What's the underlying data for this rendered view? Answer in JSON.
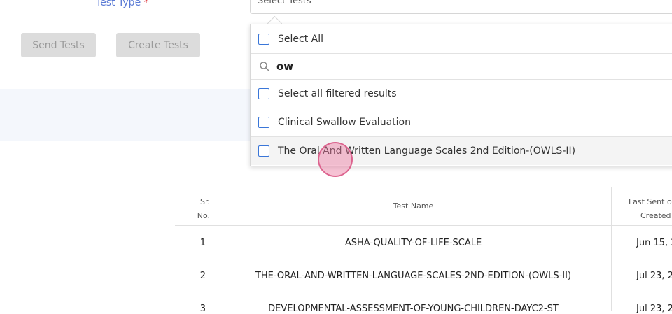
{
  "form": {
    "test_type_label": "Test Type",
    "required_mark": "*",
    "select_placeholder": "Select Tests",
    "send_tests_button": "Send Tests",
    "create_tests_button": "Create Tests"
  },
  "dropdown": {
    "select_all": "Select All",
    "search_value": "ow",
    "select_all_filtered": "Select all filtered results",
    "options": [
      {
        "label": "Clinical Swallow Evaluation",
        "checked": false
      },
      {
        "label": "The Oral And Written Language Scales 2nd Edition-(OWLS-II)",
        "checked": false
      }
    ]
  },
  "table": {
    "headers": {
      "sr_line1": "Sr.",
      "sr_line2": "No.",
      "test_name": "Test Name",
      "last_sent_line1": "Last Sent o",
      "last_sent_line2": "Created"
    },
    "rows": [
      {
        "sr": "1",
        "name": "ASHA-QUALITY-OF-LIFE-SCALE",
        "date": "Jun 15, 2"
      },
      {
        "sr": "2",
        "name": "THE-ORAL-AND-WRITTEN-LANGUAGE-SCALES-2ND-EDITION-(OWLS-II)",
        "date": "Jul 23, 2"
      },
      {
        "sr": "3",
        "name": "DEVELOPMENTAL-ASSESSMENT-OF-YOUNG-CHILDREN-DAYC2-ST",
        "date": "Jul 23, 2"
      }
    ]
  },
  "colors": {
    "label_blue": "#5b7bd5",
    "checkbox_blue": "#3a76d8",
    "cursor_pink": "#e87ba0"
  }
}
